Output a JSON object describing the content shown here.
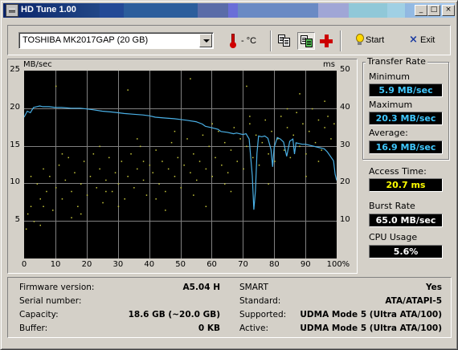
{
  "window": {
    "title": "HD Tune 1.00"
  },
  "title_buttons": {
    "minimize": "_",
    "maximize": "□",
    "close": "×"
  },
  "toolbar": {
    "drive": "TOSHIBA MK2017GAP (20 GB)",
    "temperature": "- °C",
    "start_label": "Start",
    "exit_label": "Exit",
    "exit_icon": "×",
    "icons": [
      "thermometer-icon",
      "copy-icon",
      "copy-all-icon",
      "health-cross-icon",
      "bulb-icon",
      "exit-x-icon"
    ]
  },
  "transfer_rate": {
    "title": "Transfer Rate",
    "minimum_label": "Minimum",
    "minimum": "5.9 MB/sec",
    "maximum_label": "Maximum",
    "maximum": "20.3 MB/sec",
    "average_label": "Average:",
    "average": "16.9 MB/sec"
  },
  "access_time": {
    "label": "Access Time:",
    "value": "20.7 ms"
  },
  "burst_rate": {
    "label": "Burst Rate",
    "value": "65.0 MB/sec"
  },
  "cpu_usage": {
    "label": "CPU Usage",
    "value": "5.6%"
  },
  "colors": {
    "cyan_value": "#40c8ff",
    "yellow_value": "#ffff00",
    "white_value": "#ffffff",
    "plot_bg": "#000000",
    "grid": "#808080",
    "transfer_line": "#4ab0e6",
    "access_dots": "#c8c83c"
  },
  "info": {
    "firmware_label": "Firmware version:",
    "firmware": "A5.04 H",
    "serial_label": "Serial number:",
    "serial": "",
    "capacity_label": "Capacity:",
    "capacity": "18.6 GB (~20.0 GB)",
    "buffer_label": "Buffer:",
    "buffer": "0 KB",
    "smart_label": "SMART",
    "smart": "Yes",
    "standard_label": "Standard:",
    "standard": "ATA/ATAPI-5",
    "supported_label": "Supported:",
    "supported": "UDMA Mode 5 (Ultra ATA/100)",
    "active_label": "Active:",
    "active": "UDMA Mode 5 (Ultra ATA/100)"
  },
  "chart_data": {
    "type": "line",
    "xlabel": "",
    "ylabel": "MB/sec",
    "y2label": "ms",
    "xlim": [
      0,
      100
    ],
    "ylim": [
      0,
      25
    ],
    "y2lim": [
      0,
      50
    ],
    "x_ticks": [
      "0",
      "10",
      "20",
      "30",
      "40",
      "50",
      "60",
      "70",
      "80",
      "90",
      "100%"
    ],
    "y_ticks": [
      "5",
      "10",
      "15",
      "20",
      "25"
    ],
    "y2_ticks": [
      "10",
      "20",
      "30",
      "40",
      "50"
    ],
    "grid": true,
    "series": [
      {
        "x": [
          0,
          1,
          2,
          3,
          4,
          5,
          6,
          8,
          10,
          12,
          15,
          18,
          20,
          22,
          25,
          28,
          30,
          32,
          35,
          38,
          40,
          42,
          45,
          48,
          50,
          52,
          55,
          57,
          58,
          60,
          62,
          63,
          65,
          67,
          68,
          70,
          71,
          72,
          73,
          73.5,
          74,
          74.5,
          75,
          76,
          77,
          78,
          79,
          79.5,
          80,
          81,
          82,
          83,
          84,
          85,
          86,
          86.5,
          87,
          88,
          89,
          90,
          92,
          94,
          96,
          97,
          98,
          99,
          99.5,
          100
        ],
        "y": [
          18.8,
          19.6,
          19.4,
          20.1,
          20.2,
          20.3,
          20.2,
          20.2,
          20.1,
          20.1,
          20.0,
          20.0,
          19.9,
          19.8,
          19.6,
          19.5,
          19.4,
          19.3,
          19.2,
          19.1,
          19.0,
          18.8,
          18.7,
          18.6,
          18.5,
          18.4,
          18.2,
          17.9,
          17.6,
          17.4,
          17.2,
          16.9,
          16.8,
          16.6,
          16.7,
          16.5,
          16.6,
          15.9,
          11.0,
          6.5,
          9.0,
          14.0,
          16.3,
          16.2,
          16.3,
          16.0,
          14.5,
          12.2,
          14.8,
          16.1,
          15.9,
          15.5,
          13.6,
          15.6,
          15.9,
          13.9,
          15.4,
          15.3,
          15.2,
          15.2,
          15.0,
          14.8,
          14.6,
          14.2,
          13.6,
          13.0,
          11.2,
          10.4
        ]
      },
      {
        "sample_points_ms": [
          [
            0.5,
            8
          ],
          [
            1,
            12
          ],
          [
            2,
            14
          ],
          [
            3,
            10
          ],
          [
            4,
            20
          ],
          [
            5,
            16
          ],
          [
            6,
            24
          ],
          [
            7,
            18
          ],
          [
            8,
            22
          ],
          [
            9,
            13
          ],
          [
            10,
            19
          ],
          [
            11,
            25
          ],
          [
            12,
            16
          ],
          [
            13,
            21
          ],
          [
            14,
            27
          ],
          [
            15,
            18
          ],
          [
            16,
            23
          ],
          [
            17,
            14
          ],
          [
            18,
            20
          ],
          [
            19,
            26
          ],
          [
            20,
            17
          ],
          [
            21,
            22
          ],
          [
            22,
            28
          ],
          [
            23,
            19
          ],
          [
            24,
            24
          ],
          [
            25,
            15
          ],
          [
            26,
            21
          ],
          [
            27,
            27
          ],
          [
            28,
            18
          ],
          [
            29,
            23
          ],
          [
            30,
            20
          ],
          [
            31,
            26
          ],
          [
            32,
            16
          ],
          [
            33,
            22
          ],
          [
            34,
            28
          ],
          [
            35,
            19
          ],
          [
            36,
            24
          ],
          [
            37,
            30
          ],
          [
            38,
            21
          ],
          [
            39,
            17
          ],
          [
            40,
            25
          ],
          [
            41,
            23
          ],
          [
            42,
            29
          ],
          [
            43,
            20
          ],
          [
            44,
            26
          ],
          [
            45,
            18
          ],
          [
            46,
            24
          ],
          [
            47,
            31
          ],
          [
            48,
            22
          ],
          [
            49,
            27
          ],
          [
            50,
            19
          ],
          [
            51,
            25
          ],
          [
            52,
            32
          ],
          [
            53,
            23
          ],
          [
            54,
            28
          ],
          [
            55,
            21
          ],
          [
            56,
            26
          ],
          [
            57,
            33
          ],
          [
            58,
            24
          ],
          [
            59,
            30
          ],
          [
            60,
            22
          ],
          [
            61,
            27
          ],
          [
            62,
            34
          ],
          [
            63,
            25
          ],
          [
            64,
            31
          ],
          [
            65,
            23
          ],
          [
            66,
            29
          ],
          [
            67,
            35
          ],
          [
            68,
            26
          ],
          [
            69,
            32
          ],
          [
            70,
            24
          ],
          [
            71,
            30
          ],
          [
            72,
            36
          ],
          [
            73,
            27
          ],
          [
            74,
            33
          ],
          [
            75,
            25
          ],
          [
            76,
            31
          ],
          [
            77,
            37
          ],
          [
            78,
            28
          ],
          [
            79,
            34
          ],
          [
            80,
            26
          ],
          [
            81,
            32
          ],
          [
            82,
            38
          ],
          [
            83,
            29
          ],
          [
            84,
            35
          ],
          [
            85,
            27
          ],
          [
            86,
            33
          ],
          [
            87,
            39
          ],
          [
            88,
            30
          ],
          [
            89,
            36
          ],
          [
            90,
            28
          ],
          [
            91,
            34
          ],
          [
            92,
            40
          ],
          [
            93,
            31
          ],
          [
            94,
            37
          ],
          [
            95,
            29
          ],
          [
            96,
            35
          ],
          [
            97,
            38
          ],
          [
            98,
            32
          ],
          [
            99,
            36
          ],
          [
            2,
            22
          ],
          [
            6,
            14
          ],
          [
            12,
            28
          ],
          [
            18,
            12
          ],
          [
            24,
            30
          ],
          [
            30,
            14
          ],
          [
            36,
            32
          ],
          [
            42,
            16
          ],
          [
            48,
            34
          ],
          [
            54,
            17
          ],
          [
            60,
            36
          ],
          [
            66,
            18
          ],
          [
            72,
            38
          ],
          [
            78,
            20
          ],
          [
            84,
            40
          ],
          [
            90,
            22
          ],
          [
            96,
            42
          ],
          [
            5,
            9
          ],
          [
            15,
            11
          ],
          [
            45,
            13
          ],
          [
            33,
            45
          ],
          [
            53,
            48
          ],
          [
            71,
            46
          ],
          [
            88,
            44
          ],
          [
            10,
            46
          ],
          [
            26,
            18
          ],
          [
            64,
            20
          ],
          [
            38,
            26
          ],
          [
            58,
            14
          ],
          [
            94,
            26
          ]
        ]
      }
    ]
  }
}
